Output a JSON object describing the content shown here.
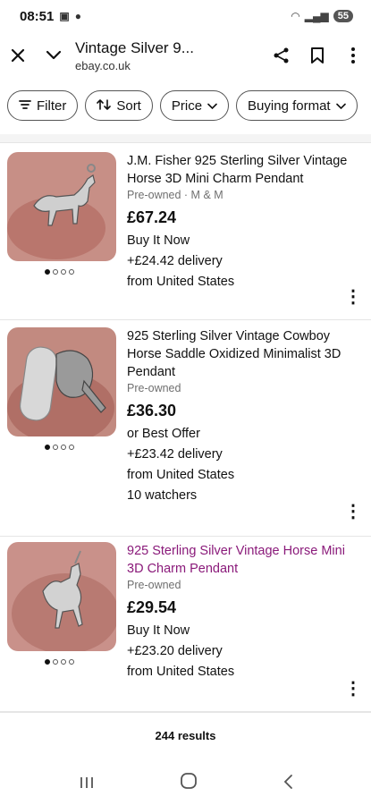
{
  "status_bar": {
    "time": "08:51",
    "battery": "55"
  },
  "browser": {
    "page_title": "Vintage Silver 9...",
    "url": "ebay.co.uk"
  },
  "filters": [
    {
      "label": "Filter",
      "icon": "filter-icon"
    },
    {
      "label": "Sort",
      "icon": "sort-icon"
    },
    {
      "label": "Price",
      "icon": "chevron-down-icon"
    },
    {
      "label": "Buying format",
      "icon": "chevron-down-icon"
    }
  ],
  "listings": [
    {
      "title": "J.M. Fisher 925 Sterling Silver Vintage Horse 3D Mini Charm Pendant",
      "condition": "Pre-owned · M & M",
      "price": "£67.24",
      "format": "Buy It Now",
      "delivery": "+£24.42 delivery",
      "location": "from United States",
      "watchers": ""
    },
    {
      "title": "925 Sterling Silver Vintage Cowboy Horse Saddle Oxidized Minimalist 3D Pendant",
      "condition": "Pre-owned",
      "price": "£36.30",
      "format": "or Best Offer",
      "delivery": "+£23.42 delivery",
      "location": "from United States",
      "watchers": "10 watchers"
    },
    {
      "title": "925 Sterling Silver Vintage Horse Mini 3D Charm Pendant",
      "condition": "Pre-owned",
      "price": "£29.54",
      "format": "Buy It Now",
      "delivery": "+£23.20 delivery",
      "location": "from United States",
      "watchers": ""
    }
  ],
  "results_count": "244 results"
}
